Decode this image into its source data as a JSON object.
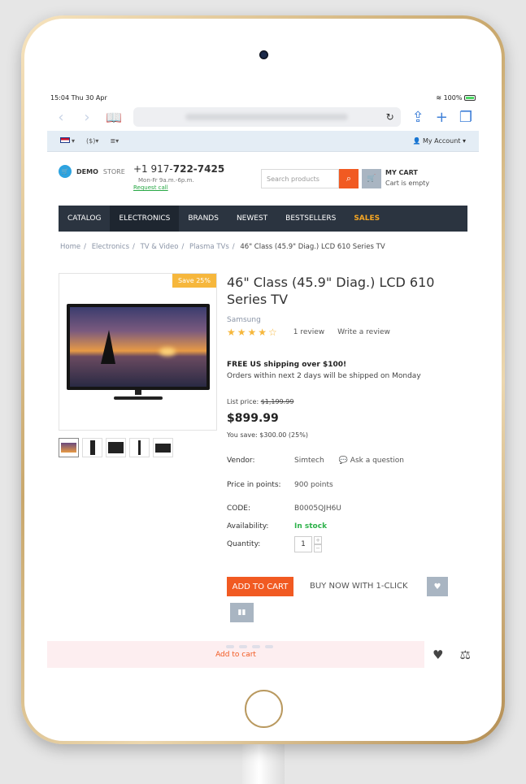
{
  "status": {
    "time": "15:04  Thu 30 Apr",
    "battery": "100%"
  },
  "topbar": {
    "currency": "($)",
    "account": "My Account"
  },
  "header": {
    "logo_bold": "DEMO",
    "logo_light": "STORE",
    "phone_prefix": "+1 917-",
    "phone_main": "722-7425",
    "hours": "Mon-Fr 9a.m.-6p.m.",
    "request_call": "Request call",
    "search_placeholder": "Search products",
    "cart_title": "MY CART",
    "cart_status": "Cart is empty"
  },
  "menu": [
    {
      "label": "CATALOG"
    },
    {
      "label": "ELECTRONICS"
    },
    {
      "label": "BRANDS"
    },
    {
      "label": "NEWEST"
    },
    {
      "label": "BESTSELLERS"
    },
    {
      "label": "SALES"
    }
  ],
  "breadcrumb": {
    "items": [
      "Home",
      "Electronics",
      "TV & Video",
      "Plasma TVs"
    ],
    "current": "46\" Class (45.9\" Diag.) LCD 610 Series TV"
  },
  "product": {
    "save_badge": "Save 25%",
    "title": "46\" Class (45.9\" Diag.) LCD 610 Series TV",
    "brand": "Samsung",
    "rating": 4,
    "stars": "★★★★☆",
    "reviews": "1 review",
    "write_review": "Write a review",
    "shipping_title": "FREE US shipping over $100!",
    "shipping_note": "Orders within next 2 days will be shipped on Monday",
    "list_price_label": "List price:",
    "list_price": "$1,199.99",
    "price": "$899.99",
    "you_save": "You save: $300.00 (25%)",
    "vendor_label": "Vendor:",
    "vendor": "Simtech",
    "ask_question": "Ask a question",
    "points_label": "Price in points:",
    "points": "900 points",
    "code_label": "CODE:",
    "code": "B0005QJH6U",
    "availability_label": "Availability:",
    "availability": "In stock",
    "quantity_label": "Quantity:",
    "quantity": "1",
    "add_to_cart": "ADD TO CART",
    "buy_now": "BUY NOW WITH 1-CLICK"
  },
  "bottom": {
    "add_to_cart": "Add to cart"
  },
  "colors": {
    "accent": "#f15a22",
    "menu_bg": "#2b3440",
    "sales": "#f6a623",
    "in_stock": "#2db24a",
    "badge": "#f6b73c"
  }
}
